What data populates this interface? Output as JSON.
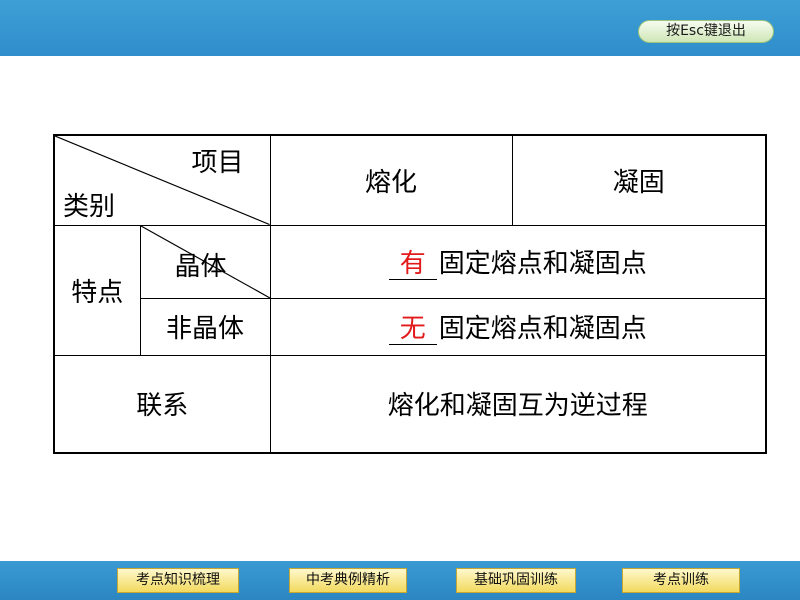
{
  "header": {
    "exit_label": "按Esc键退出"
  },
  "table": {
    "header_item": "项目",
    "header_category": "类别",
    "col_melting": "熔化",
    "col_solidifying": "凝固",
    "feature_label": "特点",
    "rows": [
      {
        "label": "晶体",
        "answer": "有",
        "text": "固定熔点和凝固点"
      },
      {
        "label": "非晶体",
        "answer": "无",
        "text": "固定熔点和凝固点"
      }
    ],
    "relation_label": "联系",
    "relation_text": "熔化和凝固互为逆过程"
  },
  "nav": {
    "items": [
      "考点知识梳理",
      "中考典例精析",
      "基础巩固训练",
      "考点训练"
    ]
  },
  "colors": {
    "accent_blue": "#3e9fd6",
    "answer_red": "#e21a1a",
    "button_yellow": "#f2d95e",
    "button_green": "#cfe7b6"
  }
}
